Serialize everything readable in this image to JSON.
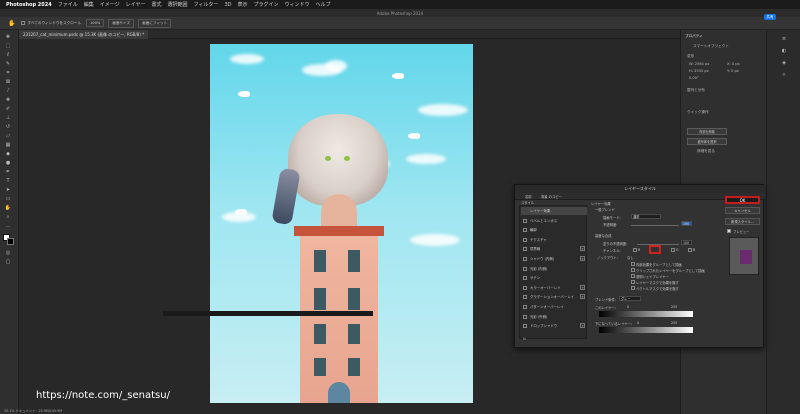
{
  "menubar": {
    "app": "Photoshop 2024",
    "items": [
      "ファイル",
      "編集",
      "イメージ",
      "レイヤー",
      "書式",
      "選択範囲",
      "フィルター",
      "3D",
      "表示",
      "プラグイン",
      "ウィンドウ",
      "ヘルプ"
    ]
  },
  "window_title": "Adobe Photoshop 2024",
  "share_label": "共有",
  "options": {
    "scroll_all": "すべてのウィンドウをスクロール",
    "zoom": "100%",
    "fit_screen": "画面サイズ",
    "fill_screen": "画面にフィット"
  },
  "document_tab": "231207_cat_minimum.psdc @ 15.3K (画像 のコピー, RGB/8) *",
  "properties": {
    "header": "プロパティ",
    "sub": "スマートオブジェクト",
    "section_transform": "変形",
    "w": "W: 2564 px",
    "h": "H: 3533 px",
    "x": "X: 0 px",
    "y": "Y: 0 px",
    "angle": "0.00°",
    "section_align": "整列と分布",
    "section_quick": "クイック操作",
    "btn1": "背景を削除",
    "btn2": "被写体を選択",
    "btn3": "詳細を見る"
  },
  "dialog": {
    "title": "レイヤースタイル",
    "nav": [
      "名前",
      "背景 のコピー"
    ],
    "styles_header": "スタイル",
    "styles": [
      {
        "label": "レイヤー効果",
        "checkbox": false,
        "plus": false,
        "selected": true
      },
      {
        "label": "ベベルとエンボス",
        "checkbox": true,
        "plus": false
      },
      {
        "label": "輪郭",
        "checkbox": true,
        "plus": false
      },
      {
        "label": "テクスチャ",
        "checkbox": true,
        "plus": false
      },
      {
        "label": "境界線",
        "checkbox": true,
        "plus": true
      },
      {
        "label": "シャドウ (内側)",
        "checkbox": true,
        "plus": true
      },
      {
        "label": "光彩 (内側)",
        "checkbox": true,
        "plus": false
      },
      {
        "label": "サテン",
        "checkbox": true,
        "plus": false
      },
      {
        "label": "カラーオーバーレイ",
        "checkbox": true,
        "plus": true
      },
      {
        "label": "グラデーションオーバーレイ",
        "checkbox": true,
        "plus": true
      },
      {
        "label": "パターンオーバーレイ",
        "checkbox": true,
        "plus": false
      },
      {
        "label": "光彩 (外側)",
        "checkbox": true,
        "plus": false
      },
      {
        "label": "ドロップシャドウ",
        "checkbox": true,
        "plus": true
      }
    ],
    "fx_label": "fx",
    "blend_header": "レイヤー効果",
    "general_blend": "一般ブレンド",
    "blend_mode_label": "描画モード:",
    "blend_mode_value": "通常",
    "opacity_label": "不透明度:",
    "opacity_value": "100",
    "advanced_blend": "高度な合成",
    "fill_opacity_label": "塗りの不透明度:",
    "fill_opacity_value": "100",
    "channel_label": "チャンネル:",
    "channel_r": "R",
    "channel_g": "G",
    "channel_b": "B",
    "knockout_label": "ノックアウト:",
    "knockout_value": "なし",
    "options": [
      "内部効果をグループとして描画",
      "クリップされたレイヤーをグループとして描画",
      "透明シェイプレイヤー",
      "レイヤーマスクで効果を隠す",
      "ベクトルマスクで効果を隠す"
    ],
    "blend_if_label": "ブレンド条件:",
    "blend_if_value": "グレー",
    "this_layer": "このレイヤー:",
    "this_layer_min": "0",
    "this_layer_max": "255",
    "under_layer": "下になっているレイヤー:",
    "under_layer_min": "0",
    "under_layer_max": "255",
    "ok": "OK",
    "cancel": "キャンセル",
    "new_style": "新規スタイル...",
    "preview": "プレビュー",
    "preview_swatch_color": "#6a2a6e"
  },
  "watermark": "https://note.com/_senatsu/",
  "status": "33.1%   ドキュメント : 25.9M/105.9M"
}
